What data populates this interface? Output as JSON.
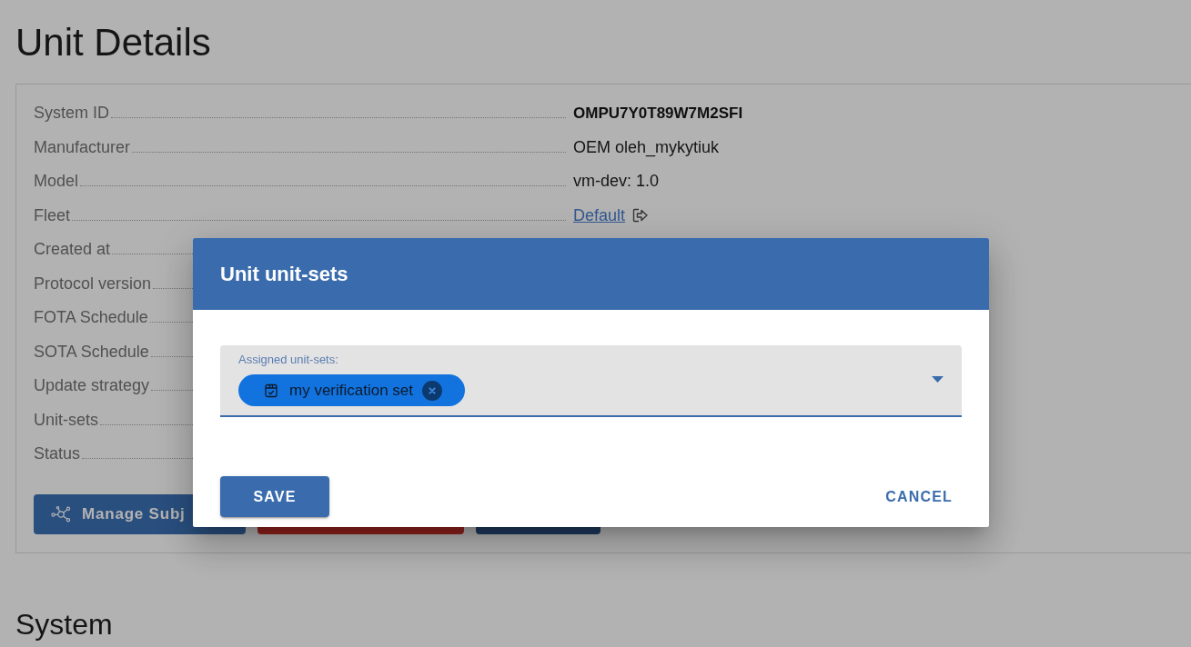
{
  "page": {
    "title": "Unit Details"
  },
  "details": [
    {
      "label": "System ID",
      "kind": "strong",
      "value": "OMPU7Y0T89W7M2SFI"
    },
    {
      "label": "Manufacturer",
      "kind": "text",
      "value": "OEM oleh_mykytiuk"
    },
    {
      "label": "Model",
      "kind": "text",
      "value": "vm-dev: 1.0"
    },
    {
      "label": "Fleet",
      "kind": "link",
      "value": "Default"
    },
    {
      "label": "Created at"
    },
    {
      "label": "Protocol version"
    },
    {
      "label": "FOTA Schedule"
    },
    {
      "label": "SOTA Schedule"
    },
    {
      "label": "Update strategy"
    },
    {
      "label": "Unit-sets"
    },
    {
      "label": "Status"
    }
  ],
  "actions": [
    {
      "kind": "primary",
      "label": "Manage Subj"
    },
    {
      "kind": "danger"
    },
    {
      "kind": "dark"
    }
  ],
  "section_title": "System",
  "dialog": {
    "title": "Unit unit-sets",
    "field": {
      "label": "Assigned unit-sets:",
      "chips": [
        {
          "label": "my verification set"
        }
      ]
    },
    "buttons": [
      {
        "kind": "contained",
        "label": "SAVE"
      },
      {
        "kind": "text",
        "label": "CANCEL"
      }
    ]
  }
}
